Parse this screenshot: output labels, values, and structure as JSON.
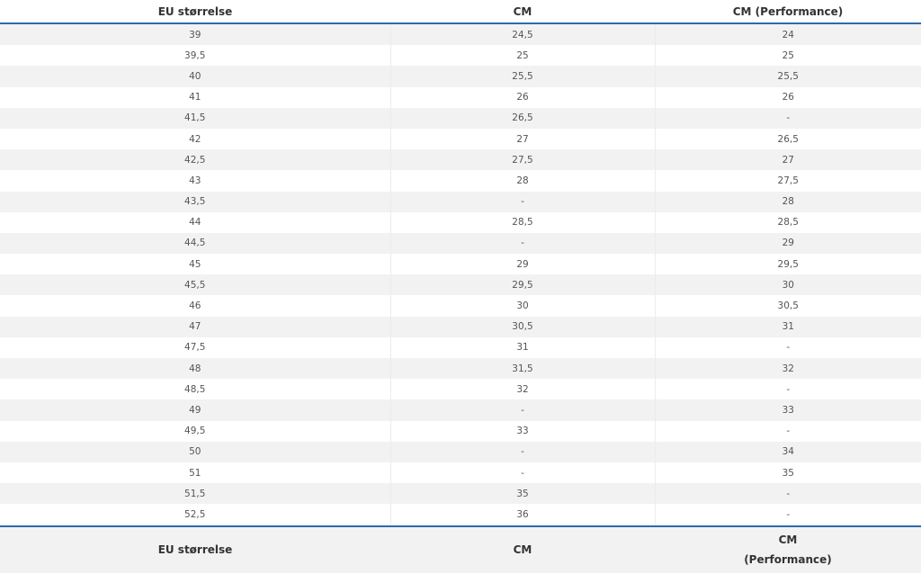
{
  "header": {
    "col1": "EU størrelse",
    "col2": "CM",
    "col3": "CM (Performance)"
  },
  "footer": {
    "col1": "EU størrelse",
    "col2": "CM",
    "col3_line1": "CM",
    "col3_line2": "(Performance)"
  },
  "rows": [
    [
      "39",
      "24,5",
      "24"
    ],
    [
      "39,5",
      "25",
      "25"
    ],
    [
      "40",
      "25,5",
      "25,5"
    ],
    [
      "41",
      "26",
      "26"
    ],
    [
      "41,5",
      "26,5",
      "-"
    ],
    [
      "42",
      "27",
      "26,5"
    ],
    [
      "42,5",
      "27,5",
      "27"
    ],
    [
      "43",
      "28",
      "27,5"
    ],
    [
      "43,5",
      "-",
      "28"
    ],
    [
      "44",
      "28,5",
      "28,5"
    ],
    [
      "44,5",
      "-",
      "29"
    ],
    [
      "45",
      "29",
      "29,5"
    ],
    [
      "45,5",
      "29,5",
      "30"
    ],
    [
      "46",
      "30",
      "30,5"
    ],
    [
      "47",
      "30,5",
      "31"
    ],
    [
      "47,5",
      "31",
      "-"
    ],
    [
      "48",
      "31,5",
      "32"
    ],
    [
      "48,5",
      "32",
      "-"
    ],
    [
      "49",
      "-",
      "33"
    ],
    [
      "49,5",
      "33",
      "-"
    ],
    [
      "50",
      "-",
      "34"
    ],
    [
      "51",
      "-",
      "35"
    ],
    [
      "51,5",
      "35",
      "-"
    ],
    [
      "52,5",
      "36",
      "-"
    ]
  ]
}
